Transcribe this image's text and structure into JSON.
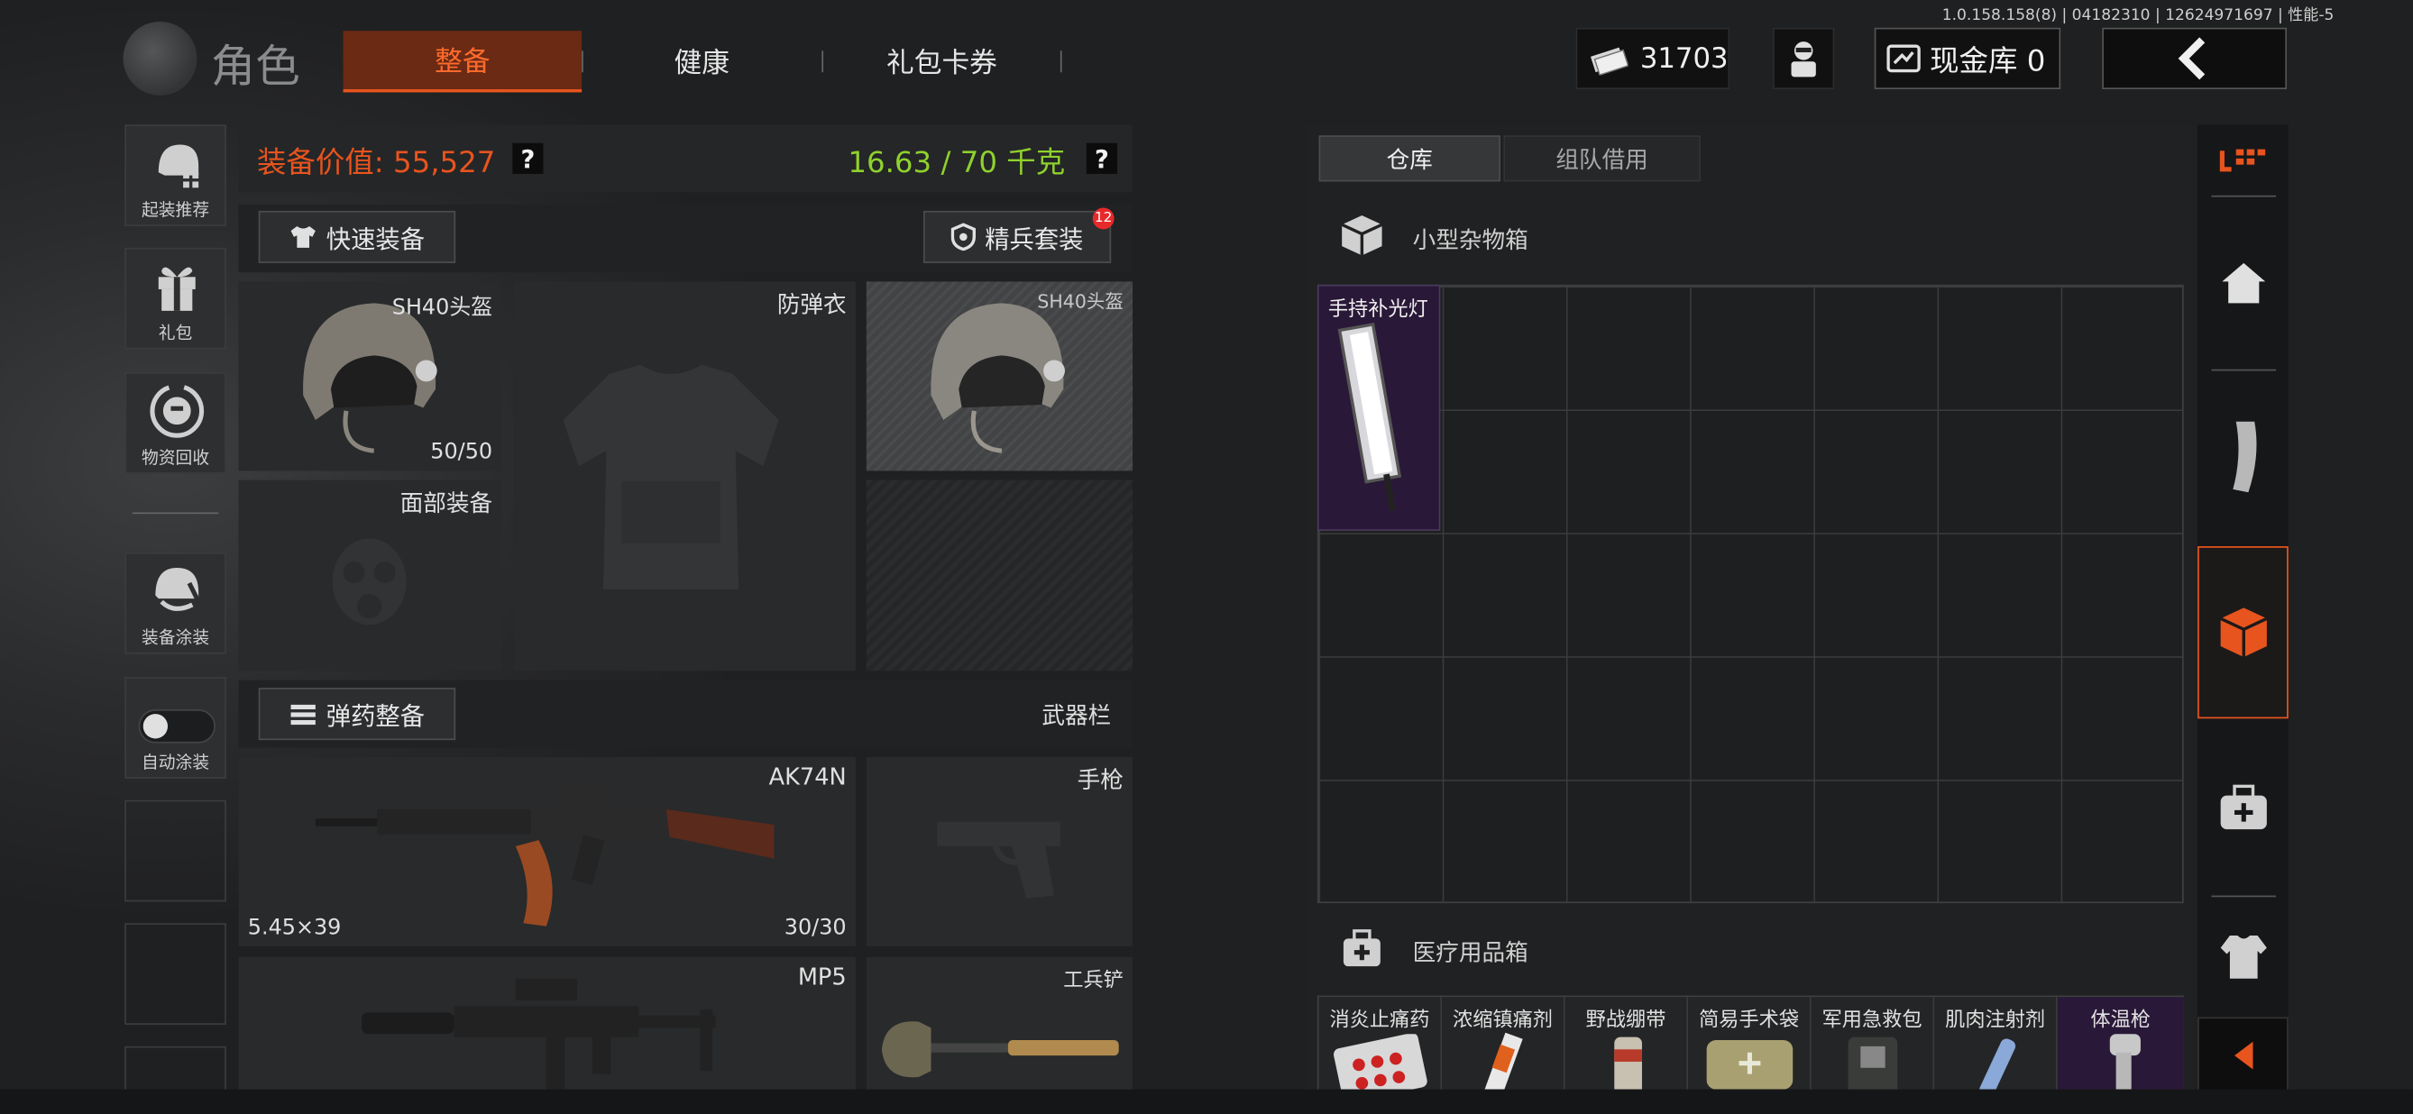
{
  "version_info": "1.0.158.158(8) | 04182310 | 12624971697 | 性能-5",
  "header": {
    "title": "角色",
    "tabs": [
      "整备",
      "健康",
      "礼包卡券"
    ],
    "active_tab": "整备",
    "money": "31703",
    "cash_vault_label": "现金库 0"
  },
  "sidebar": {
    "items": [
      "起装推荐",
      "礼包",
      "物资回收",
      "装备涂装",
      "自动涂装"
    ]
  },
  "equipment": {
    "value_label": "装备价值: 55,527",
    "weight_label": "16.63 / 70 千克",
    "help": "?",
    "quick_equip": "快速装备",
    "elite_set": "精兵套装",
    "elite_badge": "12",
    "helmet": {
      "name": "SH40头盔",
      "durability": "50/50"
    },
    "armor": {
      "name": "防弹衣"
    },
    "helmet2": {
      "name": "SH40头盔"
    },
    "face": {
      "name": "面部装备"
    },
    "ammo_button": "弹药整备",
    "weapon_bar": "武器栏",
    "primary": {
      "name": "AK74N",
      "caliber": "5.45×39",
      "ammo": "30/30"
    },
    "pistol": {
      "name": "手枪"
    },
    "secondary": {
      "name": "MP5"
    },
    "melee": {
      "name": "工兵铲"
    }
  },
  "storage": {
    "tabs": [
      "仓库",
      "组队借用"
    ],
    "active_tab": "仓库",
    "box1": {
      "title": "小型杂物箱",
      "item": "手持补光灯"
    },
    "box2": {
      "title": "医疗用品箱",
      "items": [
        "消炎止痛药",
        "浓缩镇痛剂",
        "野战绷带",
        "简易手术袋",
        "军用急救包",
        "肌肉注射剂",
        "体温枪"
      ]
    }
  },
  "colors": {
    "accent": "#e8541e",
    "weight": "#8fd12e",
    "value": "#e8541e",
    "highlight": "#2a1838"
  }
}
